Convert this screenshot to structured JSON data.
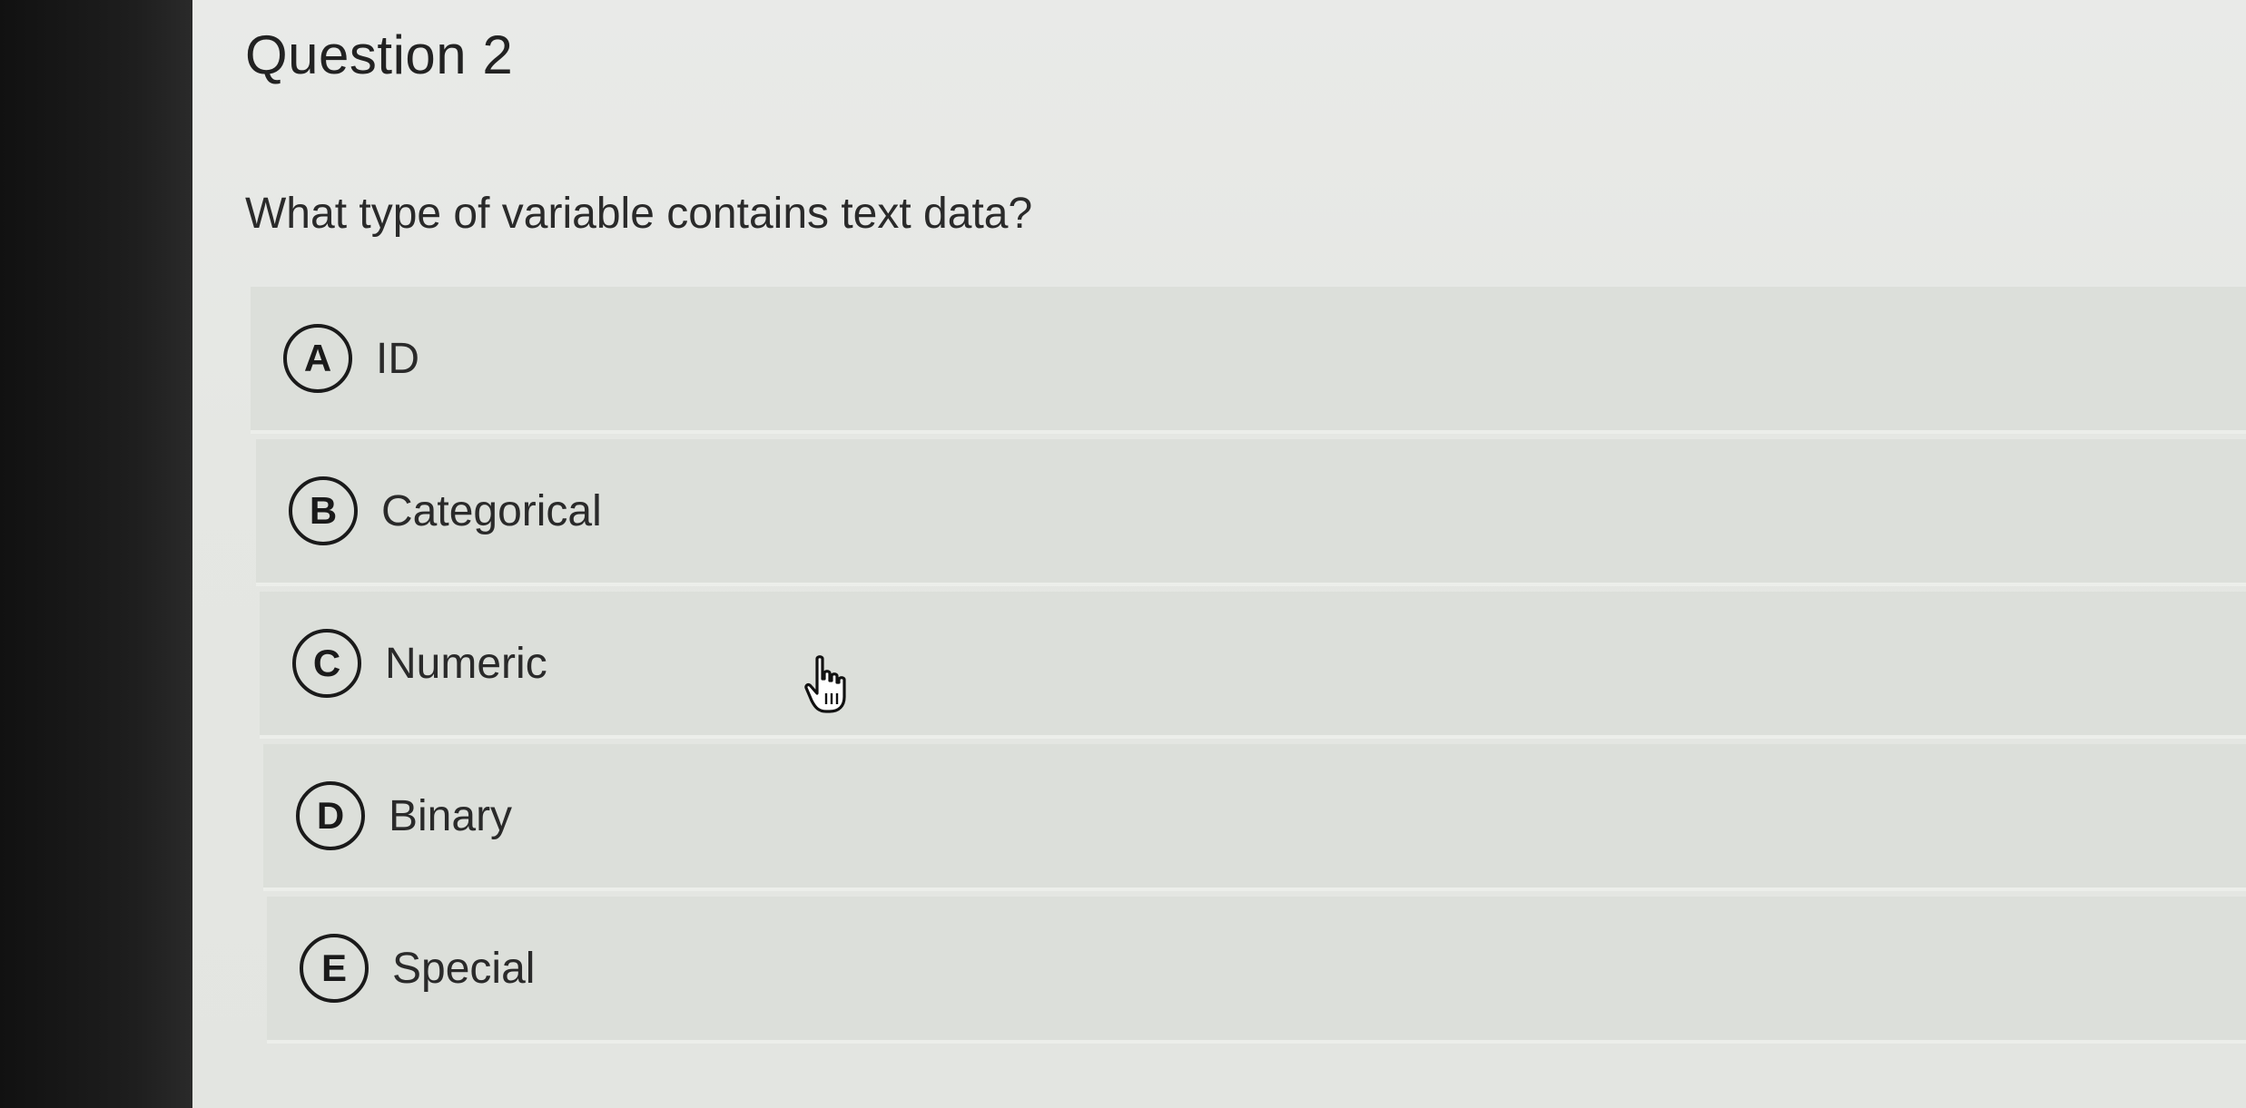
{
  "question": {
    "title": "Question 2",
    "text": "What type of variable contains text data?"
  },
  "options": [
    {
      "letter": "A",
      "label": "ID"
    },
    {
      "letter": "B",
      "label": "Categorical"
    },
    {
      "letter": "C",
      "label": "Numeric"
    },
    {
      "letter": "D",
      "label": "Binary"
    },
    {
      "letter": "E",
      "label": "Special"
    }
  ],
  "cursor": {
    "icon": "hand-pointer-icon"
  }
}
